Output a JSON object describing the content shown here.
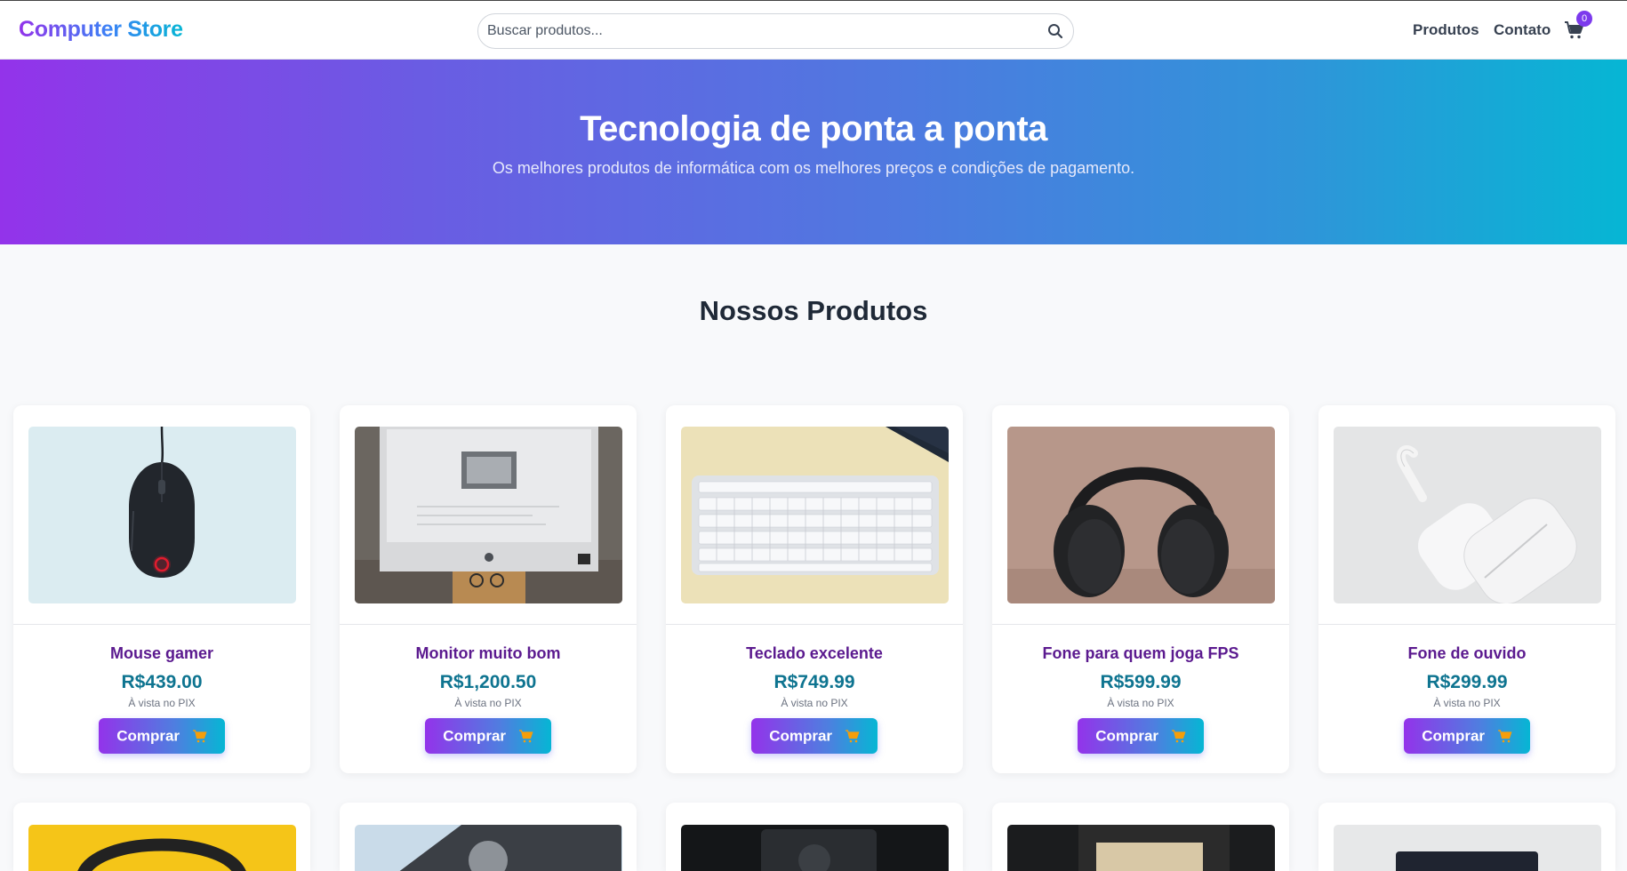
{
  "header": {
    "brand": "Computer Store",
    "search_placeholder": "Buscar produtos...",
    "nav": [
      "Produtos",
      "Contato"
    ],
    "cart_count": "0"
  },
  "hero": {
    "title": "Tecnologia de ponta a ponta",
    "subtitle": "Os melhores produtos de informática com os melhores preços e condições de pagamento."
  },
  "section": {
    "title": "Nossos Produtos"
  },
  "products": [
    {
      "name": "Mouse gamer",
      "price": "R$439.00",
      "note": "À vista no PIX",
      "buy_label": "Comprar"
    },
    {
      "name": "Monitor muito bom",
      "price": "R$1,200.50",
      "note": "À vista no PIX",
      "buy_label": "Comprar"
    },
    {
      "name": "Teclado excelente",
      "price": "R$749.99",
      "note": "À vista no PIX",
      "buy_label": "Comprar"
    },
    {
      "name": "Fone para quem joga FPS",
      "price": "R$599.99",
      "note": "À vista no PIX",
      "buy_label": "Comprar"
    },
    {
      "name": "Fone de ouvido",
      "price": "R$299.99",
      "note": "À vista no PIX",
      "buy_label": "Comprar"
    }
  ],
  "colors": {
    "brand_purple": "#9333ea",
    "brand_cyan": "#06b6d4",
    "price": "#0e7490",
    "name": "#5b1a8f"
  }
}
